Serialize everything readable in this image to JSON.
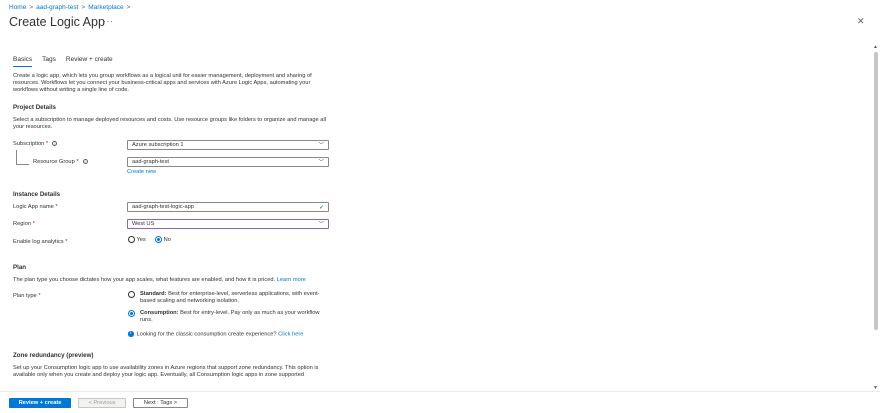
{
  "breadcrumb": {
    "home": "Home",
    "resource": "aad-graph-test",
    "marketplace": "Marketplace",
    "sep": ">"
  },
  "title": "Create Logic App",
  "more": "···",
  "close": "✕",
  "tabs": [
    "Basics",
    "Tags",
    "Review + create"
  ],
  "intro": "Create a logic app, which lets you group workflows as a logical unit for easier management, deployment and sharing of resources. Workflows let you connect your business-critical apps and services with Azure Logic Apps, automating your workflows without writing a single line of code.",
  "project": {
    "heading": "Project Details",
    "desc": "Select a subscription to manage deployed resources and costs. Use resource groups like folders to organize and manage all your resources.",
    "subscription_label": "Subscription",
    "subscription_value": "Azure subscription 1",
    "rg_label": "Resource Group",
    "rg_value": "aad-graph-test",
    "create_new": "Create new"
  },
  "instance": {
    "heading": "Instance Details",
    "name_label": "Logic App name",
    "name_value": "aad-graph-test-logic-app",
    "region_label": "Region",
    "region_value": "West US",
    "log_label": "Enable log analytics",
    "log_yes": "Yes",
    "log_no": "No",
    "log_selected": "No"
  },
  "plan": {
    "heading": "Plan",
    "desc": "The plan type you choose dictates how your app scales, what features are enabled, and how it is priced.",
    "learn_more": "Learn more",
    "type_label": "Plan type",
    "standard_title": "Standard:",
    "standard_desc": "Best for enterprise-level, serverless applications, with event-based scaling and networking isolation.",
    "consumption_title": "Consumption:",
    "consumption_desc": "Best for entry-level. Pay only as much as your workflow runs.",
    "selected": "Consumption",
    "classic_text": "Looking for the classic consumption create experience?",
    "click_here": "Click here"
  },
  "zone": {
    "heading": "Zone redundancy (preview)",
    "desc": "Set up your Consumption logic app to use availability zones in Azure regions that support zone redundancy. This option is available only when you create and deploy your logic app. Eventually, all Consumption logic apps in zone supported"
  },
  "footer": {
    "review": "Review + create",
    "previous": "< Previous",
    "next": "Next : Tags >"
  },
  "required_mark": "*",
  "info_mark": "i",
  "colors": {
    "accent": "#0078d4",
    "valid": "#107c10",
    "required": "#a4262c"
  }
}
